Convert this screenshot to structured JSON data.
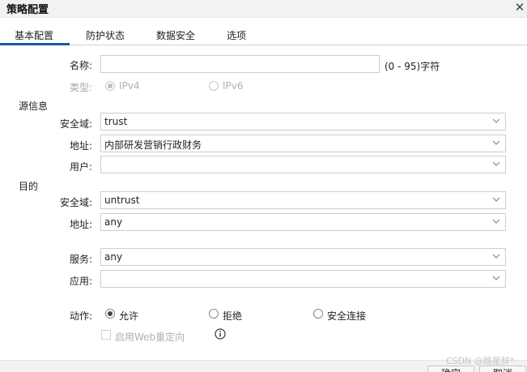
{
  "dialog": {
    "title": "策略配置"
  },
  "tabs": [
    {
      "label": "基本配置"
    },
    {
      "label": "防护状态"
    },
    {
      "label": "数据安全"
    },
    {
      "label": "选项"
    }
  ],
  "form": {
    "name": {
      "label": "名称:",
      "value": "",
      "hint": "(0 - 95)字符"
    },
    "type": {
      "label": "类型:",
      "options": [
        "IPv4",
        "IPv6"
      ],
      "selected": "IPv4",
      "disabled": true
    },
    "source": {
      "section": "源信息",
      "zone": {
        "label": "安全域:",
        "value": "trust"
      },
      "address": {
        "label": "地址:",
        "value": "内部研发营销行政财务"
      },
      "user": {
        "label": "用户:",
        "value": ""
      }
    },
    "destination": {
      "section": "目的",
      "zone": {
        "label": "安全域:",
        "value": "untrust"
      },
      "address": {
        "label": "地址:",
        "value": "any"
      }
    },
    "service": {
      "label": "服务:",
      "value": "any"
    },
    "application": {
      "label": "应用:",
      "value": ""
    },
    "action": {
      "label": "动作:",
      "options": [
        "允许",
        "拒绝",
        "安全连接"
      ],
      "selected": "允许"
    },
    "web_redirect": {
      "label": "启用Web重定向",
      "checked": false,
      "disabled": true
    }
  },
  "footer": {
    "ok_label": "确定",
    "cancel_label": "取消",
    "watermark": "CSDN @路星辞*"
  },
  "icons": {
    "close": "close-icon",
    "dropdown": "chevron-down-icon",
    "info": "info-icon"
  }
}
